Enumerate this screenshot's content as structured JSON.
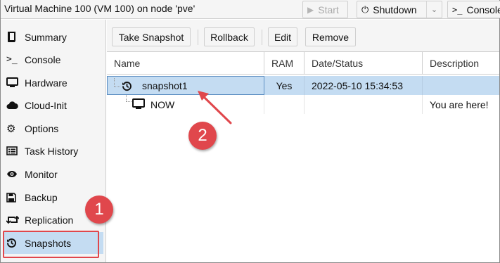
{
  "window": {
    "title": "Virtual Machine 100 (VM 100) on node 'pve'",
    "buttons": {
      "start_label": "Start",
      "shutdown_label": "Shutdown",
      "console_label": "Console"
    }
  },
  "sidebar": {
    "items": [
      {
        "label": "Summary",
        "icon": "book-icon"
      },
      {
        "label": "Console",
        "icon": "terminal-icon"
      },
      {
        "label": "Hardware",
        "icon": "monitor-icon"
      },
      {
        "label": "Cloud-Init",
        "icon": "cloud-icon"
      },
      {
        "label": "Options",
        "icon": "gear-icon"
      },
      {
        "label": "Task History",
        "icon": "list-icon"
      },
      {
        "label": "Monitor",
        "icon": "eye-icon"
      },
      {
        "label": "Backup",
        "icon": "floppy-icon"
      },
      {
        "label": "Replication",
        "icon": "retweet-icon"
      },
      {
        "label": "Snapshots",
        "icon": "history-icon"
      }
    ],
    "active": "Snapshots"
  },
  "toolbar": {
    "take_snapshot_label": "Take Snapshot",
    "rollback_label": "Rollback",
    "edit_label": "Edit",
    "remove_label": "Remove"
  },
  "grid": {
    "columns": [
      "Name",
      "RAM",
      "Date/Status",
      "Description"
    ],
    "rows": [
      {
        "name": "snapshot1",
        "ram": "Yes",
        "date": "2022-05-10 15:34:53",
        "description": "",
        "icon": "history-icon",
        "selected": true
      },
      {
        "name": "NOW",
        "ram": "",
        "date": "",
        "description": "You are here!",
        "icon": "monitor-icon",
        "selected": false
      }
    ]
  },
  "annotations": {
    "step1_label": "1",
    "step2_label": "2",
    "accent_color": "#e0474c"
  },
  "colors": {
    "selection": "#c4dcf2",
    "panel_bg": "#f5f5f5",
    "border": "#cfcfcf"
  }
}
